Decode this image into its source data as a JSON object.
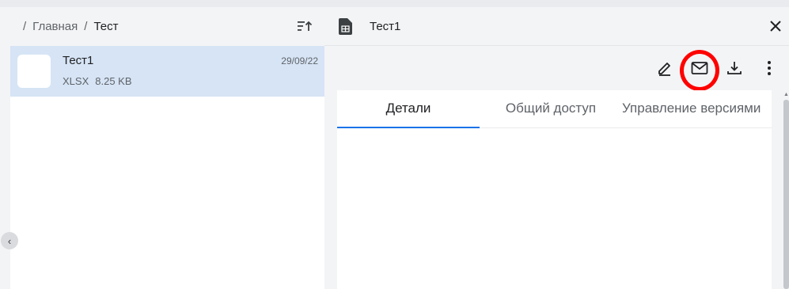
{
  "breadcrumb": {
    "separator": "/",
    "home": "Главная",
    "current": "Тест"
  },
  "icons": {
    "sort": "sort-ascending-icon",
    "doc": "spreadsheet-file-icon",
    "close": "close-icon",
    "edit": "pencil-icon",
    "email": "envelope-icon",
    "download": "download-icon",
    "more": "more-vertical-icon",
    "collapse": "chevron-left-icon"
  },
  "file_list": [
    {
      "name": "Тест1",
      "type": "XLSX",
      "size": "8.25 KB",
      "date": "29/09/22",
      "selected": true
    }
  ],
  "detail": {
    "title": "Тест1",
    "tabs": [
      {
        "label": "Детали",
        "active": true
      },
      {
        "label": "Общий доступ",
        "active": false
      },
      {
        "label": "Управление версиями",
        "active": false
      }
    ]
  },
  "colors": {
    "accent": "#1a73e8",
    "selection": "#d6e4f5",
    "annotation": "#ff0000"
  }
}
